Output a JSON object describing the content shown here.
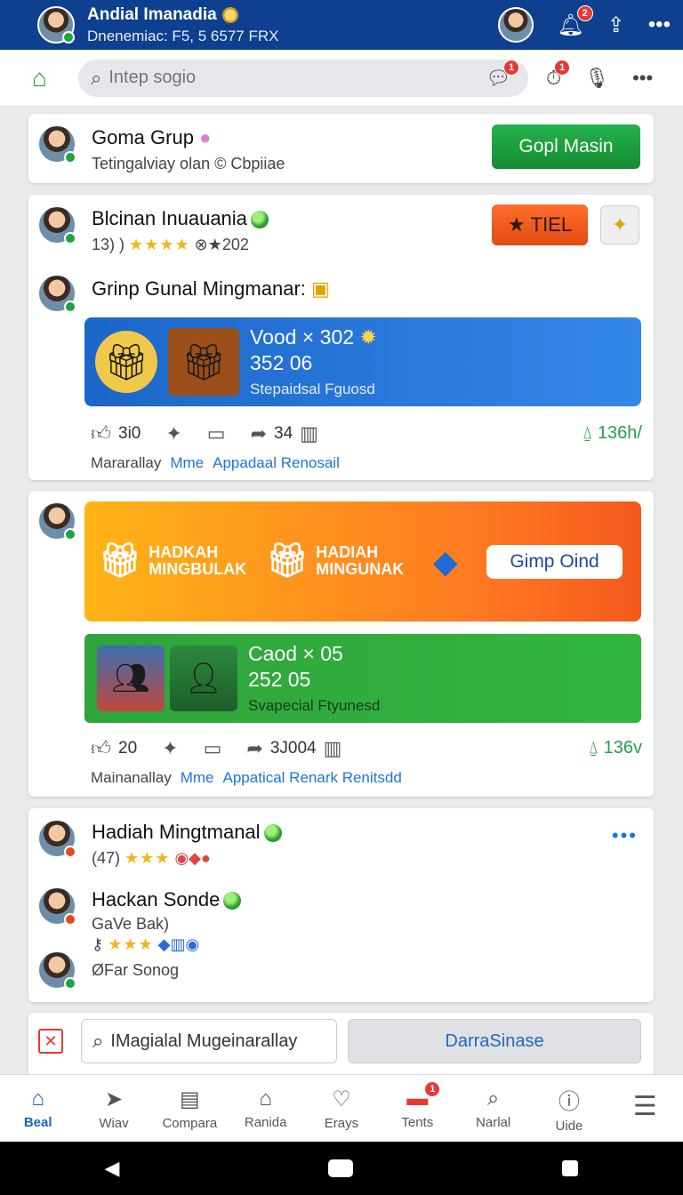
{
  "header": {
    "title": "Andial Imanadia",
    "subtitle": "Dnenemiac: F5, 5 6577 FRX",
    "notification_count": "2"
  },
  "search": {
    "placeholder": "Intep sogio",
    "chat_badge": "1",
    "alert_badge": "1"
  },
  "group_card": {
    "name": "Goma Grup",
    "subtitle": "Tetingalviay olan © Cbpiiae",
    "button": "Gopl Masin"
  },
  "post1": {
    "author": "Blcinan Inuauania",
    "meta_prefix": "13) )",
    "meta_suffix": "⊗★202",
    "stars": "★★★★",
    "button": "TIEL",
    "comment_author": "Grinp Gunal Mingmanar:",
    "promo": {
      "line1": "Vood × 302",
      "line2": "352 06",
      "line3": "Stepaidsal Fguosd"
    },
    "likes": "3i0",
    "shares": "34",
    "label_1": "Mararallay",
    "label_2": "Mme",
    "label_3": "Appadaal Renosail",
    "views": "136h/"
  },
  "post2": {
    "banner_item_1": "HADKAH MINGBULAK",
    "banner_item_2": "HADIAH MINGUNAK",
    "banner_button": "Gimp Oind",
    "promo": {
      "line1": "Caod × 05",
      "line2": "252 05",
      "line3": "Svapecial Ftyunesd"
    },
    "likes": "20",
    "shares": "3J004",
    "label_1": "Mainanallay",
    "label_2": "Mme",
    "label_3": "Appatical Renark Renitsdd",
    "views": "136v"
  },
  "list_card": {
    "item1_name": "Hadiah Mingtmanal",
    "item1_meta": "(47)",
    "item1_stars": "★★★",
    "item2_name": "Hackan Sonde",
    "item2_sub": "GaVe Bak)",
    "item2_stars": "★★★",
    "item3_name": "ØFar Sonog"
  },
  "compose": {
    "input_value": "IMagialal Mugeinarallay",
    "button": "DarraSinase"
  },
  "tabs": [
    {
      "label": "Beal"
    },
    {
      "label": "Wiav"
    },
    {
      "label": "Compara"
    },
    {
      "label": "Ranida"
    },
    {
      "label": "Erays"
    },
    {
      "label": "Tents",
      "badge": "1"
    },
    {
      "label": "Narlal"
    },
    {
      "label": "Uide"
    },
    {
      "label": ""
    }
  ],
  "colors": {
    "header_bg": "#0f3f8f",
    "accent_green": "#1f9a3c",
    "accent_blue": "#1b63c6",
    "badge_red": "#e53935"
  }
}
